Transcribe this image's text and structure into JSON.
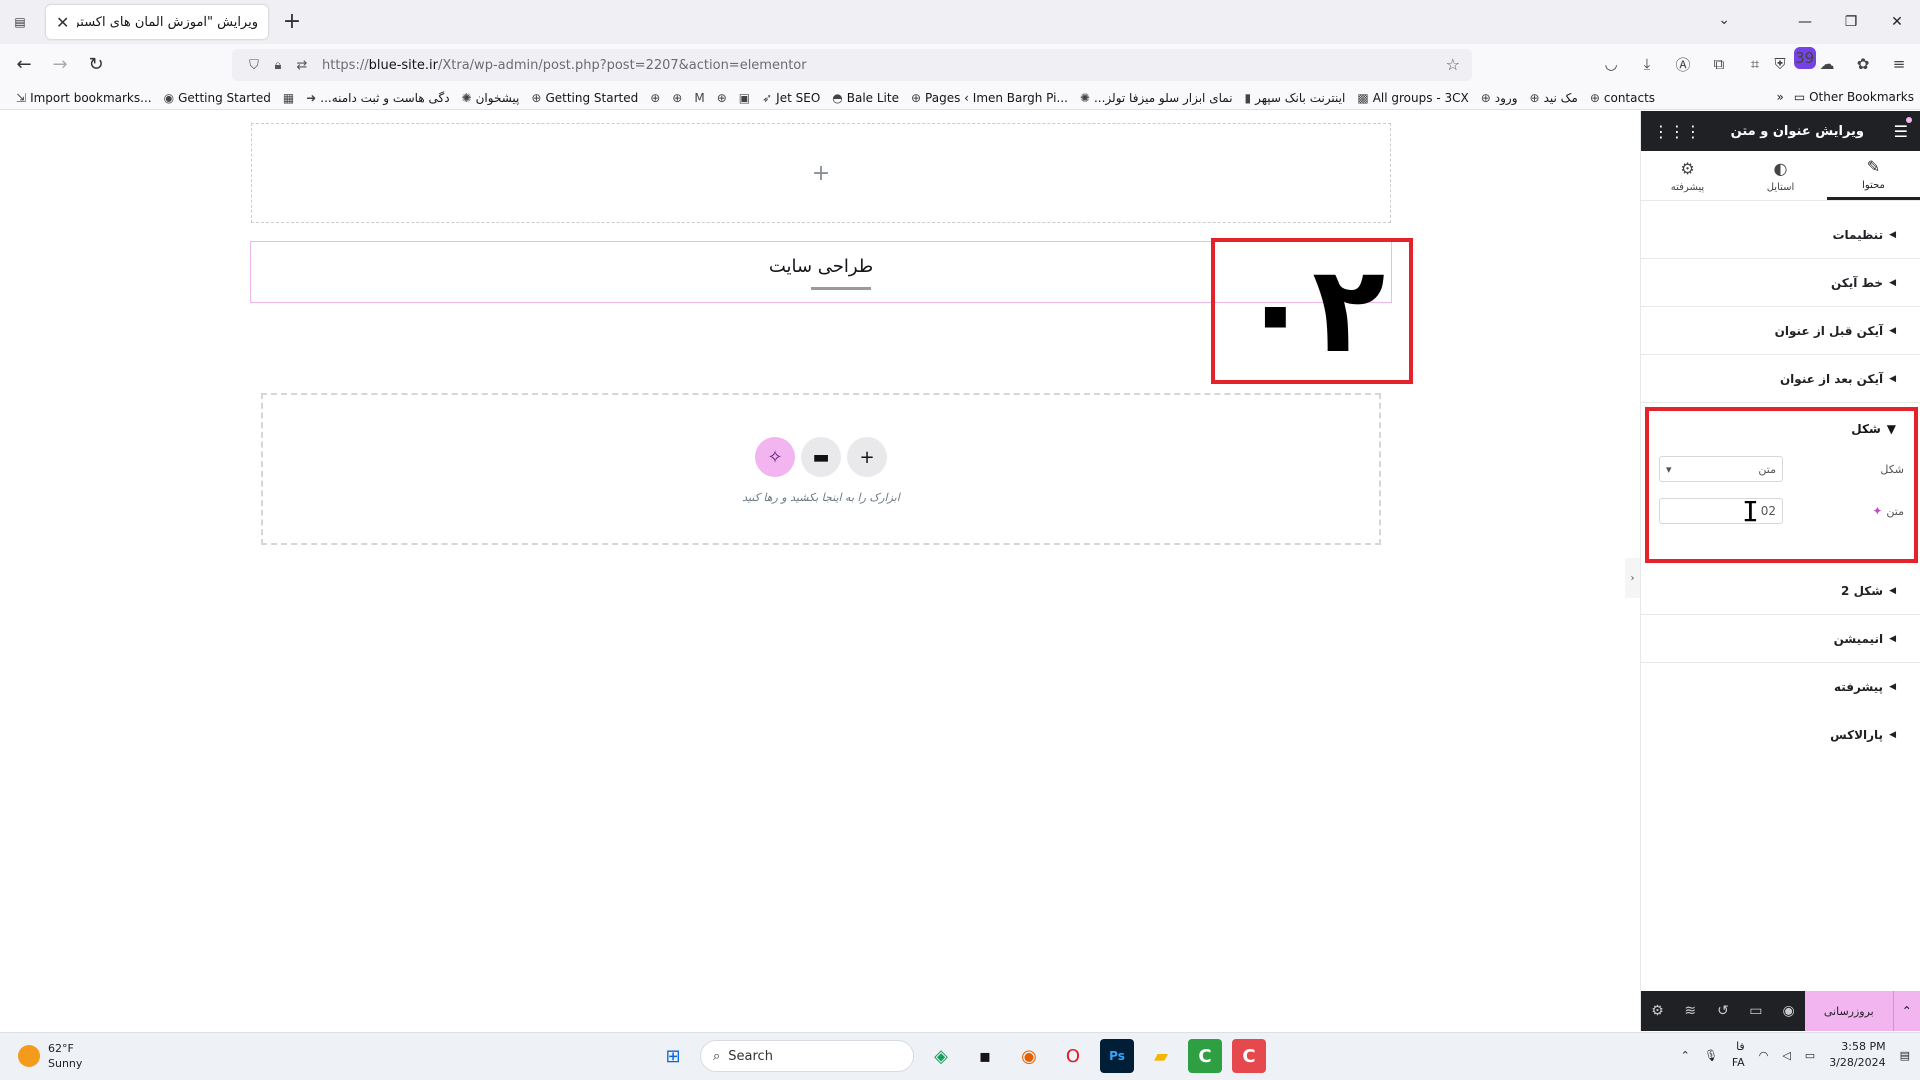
{
  "browser": {
    "tab_title": "ویرایش \"آموزش المان های اکسترا – ما",
    "url_prefix": "https://",
    "url_domain": "blue-site.ir",
    "url_path": "/Xtra/wp-admin/post.php?post=2207&action=elementor",
    "extensions_badge": "39",
    "bookmarks": [
      {
        "label": "Import bookmarks...",
        "icon": "import-icon"
      },
      {
        "label": "Getting Started",
        "icon": "firefox-icon"
      },
      {
        "label": "",
        "icon": "calendar-icon"
      },
      {
        "label": "...دگی هاست و ثبت دامنه",
        "icon": "arrow-icon"
      },
      {
        "label": "پیشخوان",
        "icon": "lion-icon"
      },
      {
        "label": "Getting Started",
        "icon": "globe-icon"
      },
      {
        "label": "",
        "icon": "globe-icon"
      },
      {
        "label": "",
        "icon": "globe-icon"
      },
      {
        "label": "",
        "icon": "gmail-icon"
      },
      {
        "label": "",
        "icon": "globe-icon"
      },
      {
        "label": "",
        "icon": "app-icon"
      },
      {
        "label": "Jet SEO",
        "icon": "rocket-icon"
      },
      {
        "label": "Bale Lite",
        "icon": "bale-icon"
      },
      {
        "label": "Pages ‹ Imen Bargh Pi...",
        "icon": "globe-icon"
      },
      {
        "label": "...نمای ابزار سلو میزفا تولز",
        "icon": "lion-icon"
      },
      {
        "label": "اینترنت بانک سپهر",
        "icon": "bank-icon"
      },
      {
        "label": "All groups - 3CX",
        "icon": "3cx-icon"
      },
      {
        "label": "ورود",
        "icon": "globe-icon"
      },
      {
        "label": "مک نید",
        "icon": "globe-icon"
      },
      {
        "label": "contacts",
        "icon": "globe-icon"
      }
    ],
    "other_bookmarks": "Other Bookmarks"
  },
  "canvas": {
    "heading_title": "طراحی سایت",
    "big_number": "۰۲",
    "drop_zone_text": "ابزارک را به اینجا بکشید و رها کنید"
  },
  "panel": {
    "header_title": "ویرایش عنوان و متن",
    "tabs": [
      {
        "label": "محتوا",
        "icon": "pencil-icon",
        "active": true
      },
      {
        "label": "استایل",
        "icon": "contrast-icon",
        "active": false
      },
      {
        "label": "پیشرفته",
        "icon": "gear-icon",
        "active": false
      }
    ],
    "sections_before": [
      {
        "label": "تنظیمات"
      },
      {
        "label": "خط آیکن"
      },
      {
        "label": "آیکن قبل از عنوان"
      },
      {
        "label": "آیکن بعد از عنوان"
      }
    ],
    "open_section": {
      "label": "شکل",
      "shape_label": "شکل",
      "shape_value": "متن",
      "text_label": "متن",
      "text_value": "02"
    },
    "sections_after": [
      {
        "label": "شکل 2"
      },
      {
        "label": "انیمیشن"
      },
      {
        "label": "پیشرفته"
      },
      {
        "label": "پارالاکس"
      }
    ],
    "publish_label": "بروزرسانی"
  },
  "taskbar": {
    "temperature": "62°F",
    "weather": "Sunny",
    "search_placeholder": "Search",
    "lang_top": "فا",
    "lang_bottom": "FA",
    "time": "3:58 PM",
    "date": "3/28/2024"
  },
  "colors": {
    "highlight_red": "#e4222a",
    "elementor_pink": "#f3b5f0",
    "panel_dark": "#1f2124"
  }
}
